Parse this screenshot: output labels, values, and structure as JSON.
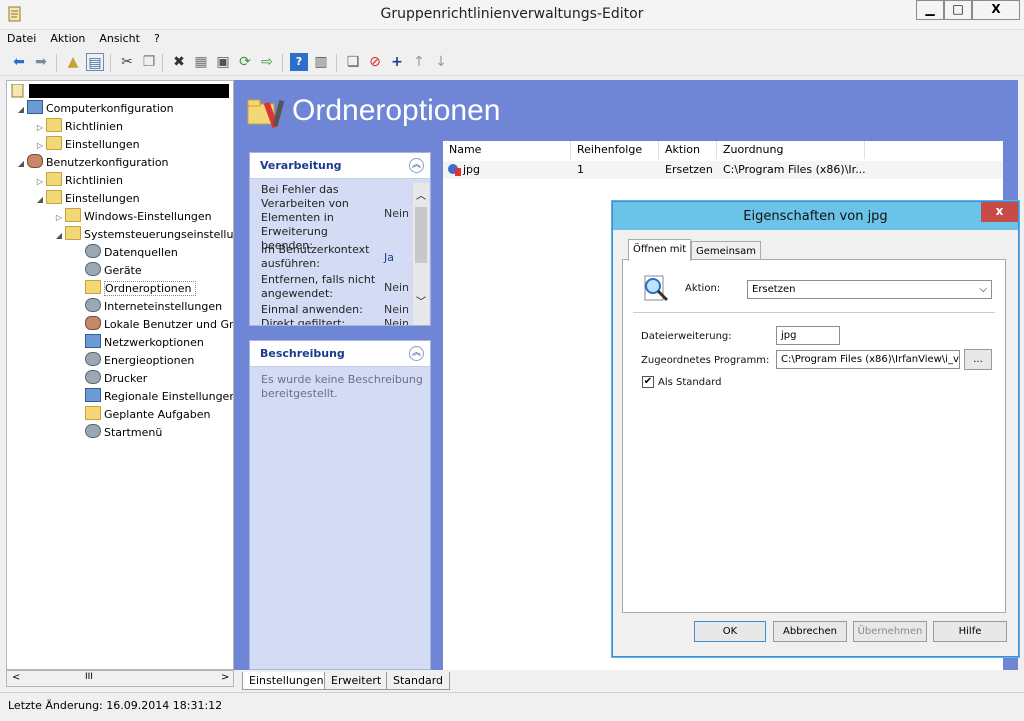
{
  "window": {
    "title": "Gruppenrichtlinienverwaltungs-Editor",
    "min": "▁",
    "max": "□",
    "close": "X"
  },
  "menu": [
    "Datei",
    "Aktion",
    "Ansicht",
    "?"
  ],
  "toolbar_icons": [
    "back-icon",
    "forward-icon",
    "up-folder-icon",
    "show-hide-tree-icon",
    "cut-icon",
    "copy-icon",
    "delete-icon",
    "properties-icon",
    "print-icon",
    "refresh-icon",
    "export-icon",
    "help-icon",
    "show-pane-icon",
    "new-item-icon",
    "stop-icon",
    "add-icon",
    "move-up-icon",
    "move-down-icon"
  ],
  "tree": {
    "root_redacted": "",
    "items": [
      {
        "label": "Computerkonfiguration"
      },
      {
        "label": "Richtlinien"
      },
      {
        "label": "Einstellungen"
      },
      {
        "label": "Benutzerkonfiguration"
      },
      {
        "label": "Richtlinien"
      },
      {
        "label": "Einstellungen"
      },
      {
        "label": "Windows-Einstellungen"
      },
      {
        "label": "Systemsteuerungseinstellur"
      },
      {
        "label": "Datenquellen"
      },
      {
        "label": "Geräte"
      },
      {
        "label": "Ordneroptionen"
      },
      {
        "label": "Interneteinstellungen"
      },
      {
        "label": "Lokale Benutzer und Gr"
      },
      {
        "label": "Netzwerkoptionen"
      },
      {
        "label": "Energieoptionen"
      },
      {
        "label": "Drucker"
      },
      {
        "label": "Regionale Einstellunger"
      },
      {
        "label": "Geplante Aufgaben"
      },
      {
        "label": "Startmenü"
      }
    ],
    "scroll_thumb": "III"
  },
  "page_title": "Ordneroptionen",
  "verarbeitung": {
    "header": "Verarbeitung",
    "rows": [
      {
        "label": "Bei Fehler das Verarbeiten von Elementen in Erweiterung beenden:",
        "value": "Nein"
      },
      {
        "label": "Im Benutzerkontext ausführen:",
        "value": "Ja"
      },
      {
        "label": "Entfernen, falls nicht angewendet:",
        "value": "Nein"
      },
      {
        "label": "Einmal anwenden:",
        "value": "Nein"
      },
      {
        "label": "Direkt gefiltert:",
        "value": "Nein"
      }
    ]
  },
  "beschreibung": {
    "header": "Beschreibung",
    "text": "Es wurde keine Beschreibung bereitgestellt."
  },
  "list": {
    "columns": [
      "Name",
      "Reihenfolge",
      "Aktion",
      "Zuordnung"
    ],
    "rows": [
      {
        "name": "jpg",
        "order": "1",
        "action": "Ersetzen",
        "assoc": "C:\\Program Files (x86)\\Ir..."
      }
    ]
  },
  "bottom_tabs": [
    "Einstellungen",
    "Erweitert",
    "Standard"
  ],
  "status": "Letzte Änderung: 16.09.2014 18:31:12",
  "dialog": {
    "title": "Eigenschaften von jpg",
    "close": "x",
    "tabs": [
      "Öffnen mit",
      "Gemeinsam"
    ],
    "aktion_label": "Aktion:",
    "aktion_value": "Ersetzen",
    "ext_label": "Dateierweiterung:",
    "ext_value": "jpg",
    "prog_label": "Zugeordnetes Programm:",
    "prog_value": "C:\\Program Files (x86)\\IrfanView\\i_v",
    "browse": "...",
    "default_label": "Als Standard",
    "default_checked": true,
    "buttons": {
      "ok": "OK",
      "cancel": "Abbrechen",
      "apply": "Übernehmen",
      "help": "Hilfe"
    }
  }
}
